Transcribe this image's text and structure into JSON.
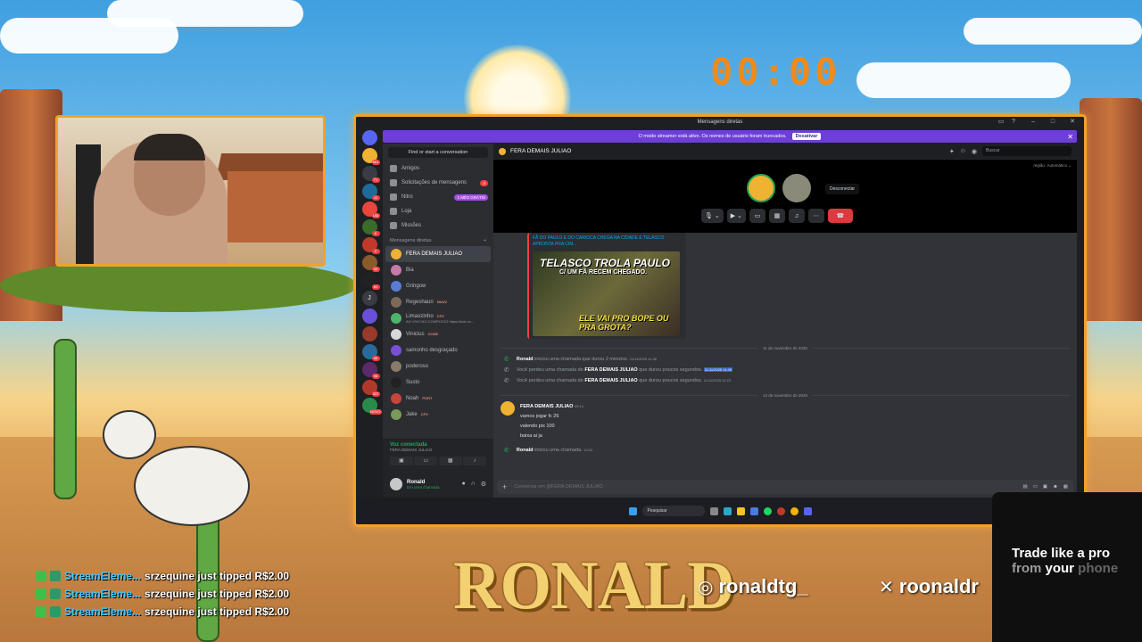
{
  "timer": "00:00",
  "window": {
    "title": "Mensagens diretas",
    "banner": {
      "text": "O modo streamer está ativo. Os nomes de usuário foram truncados.",
      "button": "Desativar"
    }
  },
  "servers": {
    "badges": [
      "",
      "661",
      "71",
      "11",
      "168",
      "6",
      "9",
      "53",
      "81",
      "",
      "",
      "",
      "66",
      "98",
      "337",
      "NOVO"
    ],
    "letter_item": "J"
  },
  "dm_sidebar": {
    "find": "Find or start a conversation",
    "nav": [
      {
        "label": "Amigos",
        "tag": ""
      },
      {
        "label": "Solicitações de mensagens",
        "tag": "4"
      },
      {
        "label": "Nitro",
        "tag": "1 MÊS GRÁTIS"
      },
      {
        "label": "Loja",
        "tag": ""
      },
      {
        "label": "Missões",
        "tag": ""
      }
    ],
    "header": "Mensagens diretas",
    "add": "+",
    "dms": [
      {
        "name": "FERA DEMAIS JULIAO",
        "sub": "",
        "pill": "",
        "color": "#f0b232"
      },
      {
        "name": "Bia",
        "sub": "",
        "pill": "",
        "color": "#c77aa7"
      },
      {
        "name": "Gringow",
        "sub": "",
        "pill": "",
        "color": "#5a7bd6"
      },
      {
        "name": "Regeshaun",
        "sub": "",
        "pill": "NUUV",
        "color": "#7b6a5a"
      },
      {
        "name": "Limaozinho",
        "sub": "AO VIVO NO COMPLEXO https://kick.co...",
        "pill": "CFX",
        "color": "#4fb36a"
      },
      {
        "name": "Vinicius",
        "sub": "",
        "pill": "CODE",
        "color": "#d9d9d9"
      },
      {
        "name": "samonho desgraçado",
        "sub": "",
        "pill": "",
        "color": "#7a4fd8"
      },
      {
        "name": "poderoso",
        "sub": "",
        "pill": "",
        "color": "#8a7a6a"
      },
      {
        "name": "Susto",
        "sub": "",
        "pill": "",
        "color": "#222222"
      },
      {
        "name": "Noah",
        "sub": "",
        "pill": "PORT",
        "color": "#c9443a"
      },
      {
        "name": "Jake",
        "sub": "",
        "pill": "CFX",
        "color": "#7a9a5a"
      }
    ],
    "voice": {
      "status": "Voz conectada",
      "channel": "FERA DEMAIS JULIAO"
    },
    "user": {
      "name": "Ronald",
      "status": "Em uma chamada"
    }
  },
  "channel": {
    "name": "FERA DEMAIS JULIAO",
    "search_placeholder": "Buscar",
    "region_label": "região",
    "region_value": "Automático",
    "tooltip": "Desconectar"
  },
  "embed": {
    "title": "FÃ DO PAULO E DO CARIOCA CHEGA NA CIDADE E TELASCO APRONTA PRA CIM...",
    "thumb_line1": "TELASCO TROLA PAULO",
    "thumb_line2": "C/ UM FÃ RECEM CHEGADO.",
    "thumb_line3": "ELE VAI PRO BOPE OU PRA GROTA?"
  },
  "messages": {
    "date1": "11 de novembro de 2025",
    "call1": {
      "name": "Ronald",
      "text": "iniciou uma chamada que durou 2 minutos.",
      "ts": "11/11/2025 11:36"
    },
    "miss1": {
      "pre": "Você perdeu uma chamada de",
      "name": "FERA DEMAIS JULIAO",
      "post": "que durou poucos segundos.",
      "ts": "11/11/2025 11:39"
    },
    "miss2": {
      "pre": "Você perdeu uma chamada de",
      "name": "FERA DEMAIS JULIAO",
      "post": "que durou poucos segundos.",
      "ts": "11/11/2025 11:23"
    },
    "date2": "13 de novembro de 2025",
    "msg": {
      "author": "FERA DEMAIS JULIAO",
      "ts": "09:14",
      "lines": [
        "vamos jogar fc 26",
        "valendo pix 100",
        "baixa ai ja"
      ]
    },
    "call2": {
      "name": "Ronald",
      "text": "iniciou uma chamada.",
      "ts": "10:03"
    }
  },
  "composer": {
    "placeholder": "Conversar em @FERA DEMAIS JULIAO"
  },
  "taskbar": {
    "search": "Pesquisar"
  },
  "chat": [
    {
      "who": "StreamEleme...",
      "text": "srzequine just tipped R$2.00"
    },
    {
      "who": "StreamEleme...",
      "text": "srzequine just tipped R$2.00"
    },
    {
      "who": "StreamEleme...",
      "text": "srzequine just tipped R$2.00"
    }
  ],
  "logo": "RONALD",
  "social": {
    "instagram": "ronaldtg_",
    "x": "roonaldr"
  },
  "ad": {
    "line1": "Trade like a pro",
    "line2a": "from ",
    "line2b": "your",
    "line2c": " phone"
  }
}
